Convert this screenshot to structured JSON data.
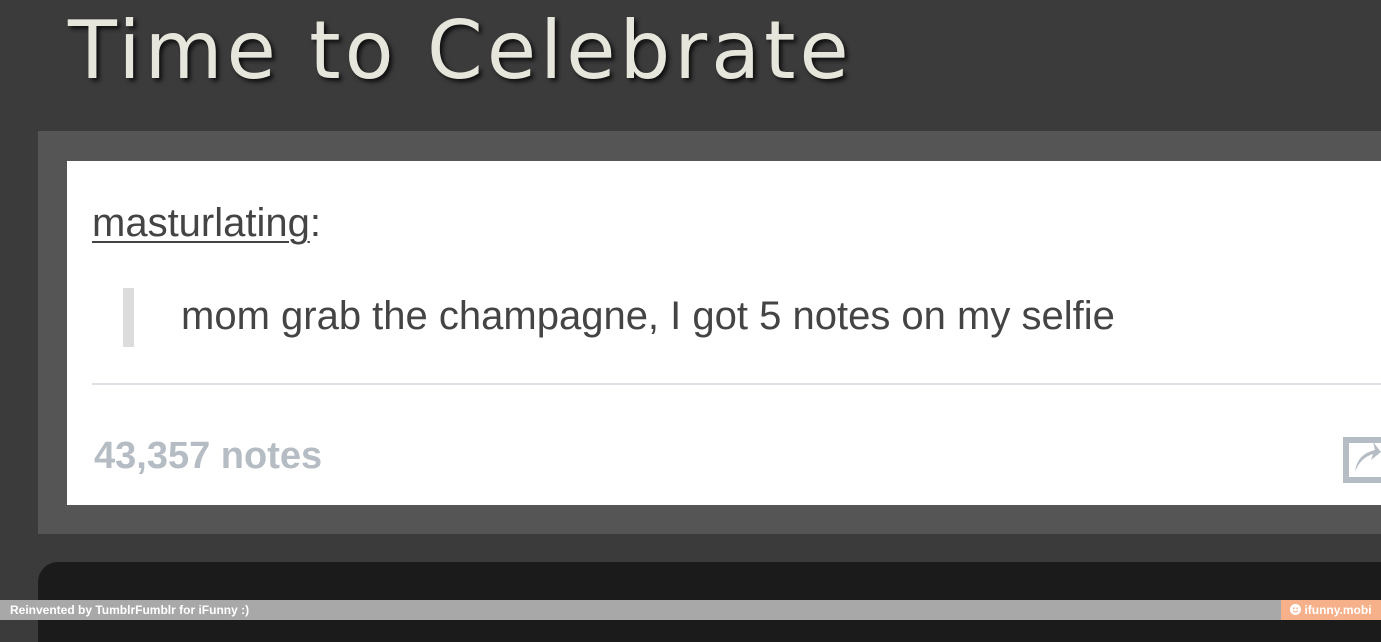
{
  "blog": {
    "title": "Time to Celebrate"
  },
  "post": {
    "author": "masturlating",
    "author_suffix": ":",
    "quote": "mom grab the champagne, I got 5 notes on my selfie",
    "notes": "43,357 notes",
    "reblog_icon": "reblog-icon"
  },
  "footer": {
    "credit": "Reinvented by TumblrFumblr for iFunny :)",
    "site": "ifunny.mobi",
    "site_icon": "smiley-icon"
  },
  "colors": {
    "page_background": "#3b3b3b",
    "card_frame": "#555555",
    "card": "#ffffff",
    "footer_bar": "#a8a8a8",
    "footer_site": "#f6b08a"
  }
}
